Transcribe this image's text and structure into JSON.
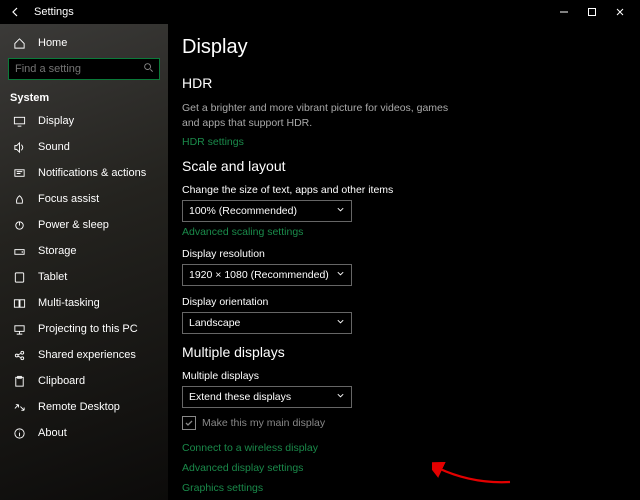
{
  "titlebar": {
    "title": "Settings"
  },
  "sidebar": {
    "home": "Home",
    "search_placeholder": "Find a setting",
    "section": "System",
    "items": [
      {
        "icon": "display-icon",
        "label": "Display"
      },
      {
        "icon": "sound-icon",
        "label": "Sound"
      },
      {
        "icon": "notifications-icon",
        "label": "Notifications & actions"
      },
      {
        "icon": "focus-icon",
        "label": "Focus assist"
      },
      {
        "icon": "power-icon",
        "label": "Power & sleep"
      },
      {
        "icon": "storage-icon",
        "label": "Storage"
      },
      {
        "icon": "tablet-icon",
        "label": "Tablet"
      },
      {
        "icon": "multitask-icon",
        "label": "Multi-tasking"
      },
      {
        "icon": "project-icon",
        "label": "Projecting to this PC"
      },
      {
        "icon": "shared-icon",
        "label": "Shared experiences"
      },
      {
        "icon": "clipboard-icon",
        "label": "Clipboard"
      },
      {
        "icon": "remote-icon",
        "label": "Remote Desktop"
      },
      {
        "icon": "about-icon",
        "label": "About"
      }
    ]
  },
  "main": {
    "page_title": "Display",
    "hdr_heading": "HDR",
    "hdr_desc": "Get a brighter and more vibrant picture for videos, games and apps that support HDR.",
    "hdr_link": "HDR settings",
    "scale_heading": "Scale and layout",
    "scale_label": "Change the size of text, apps and other items",
    "scale_value": "100% (Recommended)",
    "scale_link": "Advanced scaling settings",
    "res_label": "Display resolution",
    "res_value": "1920 × 1080 (Recommended)",
    "orient_label": "Display orientation",
    "orient_value": "Landscape",
    "multi_heading": "Multiple displays",
    "multi_label": "Multiple displays",
    "multi_value": "Extend these displays",
    "main_check": "Make this my main display",
    "wireless_link": "Connect to a wireless display",
    "adv_link": "Advanced display settings",
    "graphics_link": "Graphics settings"
  }
}
